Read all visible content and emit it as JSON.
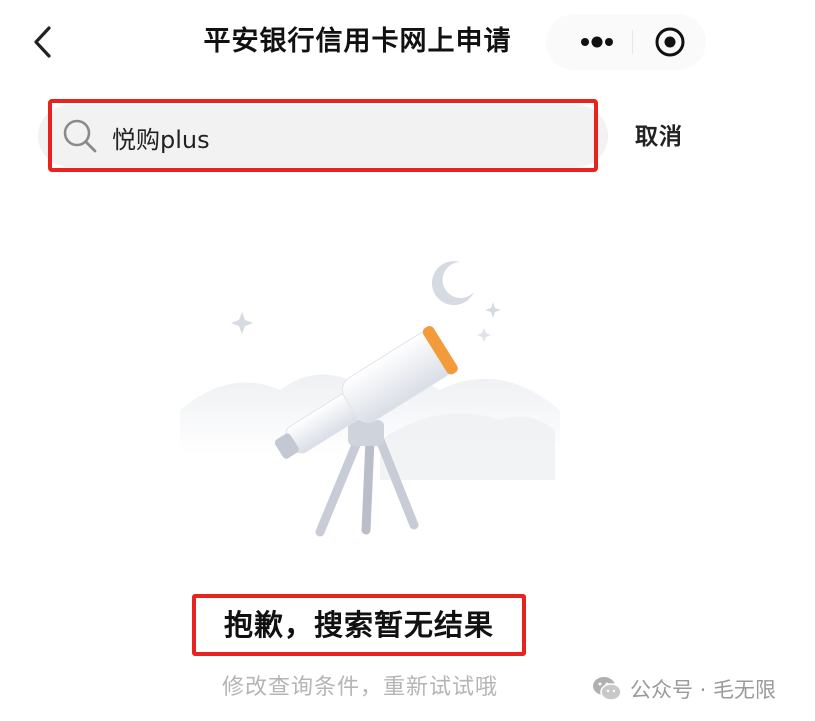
{
  "nav": {
    "title": "平安银行信用卡网上申请",
    "back_icon": "chevron-left-icon",
    "more_icon": "more-dots-icon",
    "close_icon": "target-circle-icon"
  },
  "search": {
    "value": "悦购plus",
    "icon": "search-icon",
    "cancel_label": "取消"
  },
  "empty_state": {
    "illustration": "telescope-night-sky-illustration",
    "title": "抱歉，搜索暂无结果",
    "subtitle": "修改查询条件，重新试试哦"
  },
  "watermark": {
    "icon": "wechat-icon",
    "text": "公众号 · 毛无限"
  },
  "colors": {
    "highlight_red": "#e8231f",
    "telescope_orange": "#f39a3b",
    "subtitle_gray": "#b5b5b5"
  }
}
